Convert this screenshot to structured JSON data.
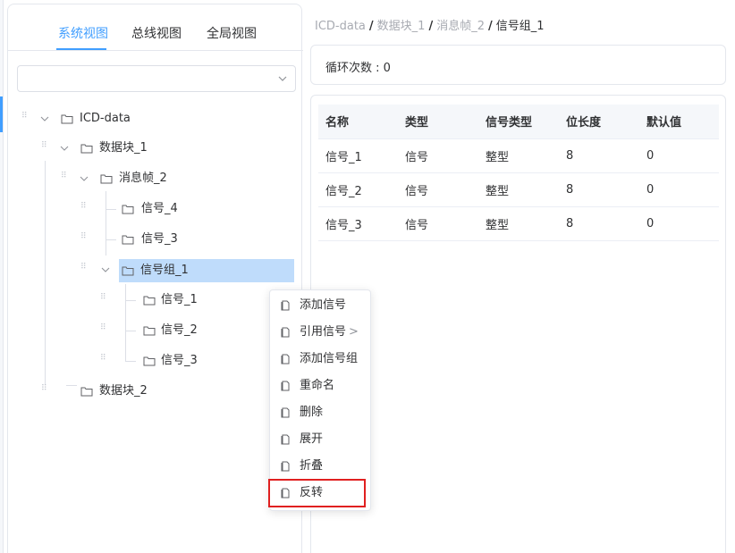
{
  "tabs": [
    {
      "label": "系统视图",
      "active": true
    },
    {
      "label": "总线视图",
      "active": false
    },
    {
      "label": "全局视图",
      "active": false
    }
  ],
  "select": {
    "value": ""
  },
  "tree": {
    "root": "ICD-data",
    "block1": "数据块_1",
    "frame2": "消息帧_2",
    "signal4": "信号_4",
    "signal3": "信号_3",
    "group1": "信号组_1",
    "g_signal1": "信号_1",
    "g_signal2": "信号_2",
    "g_signal3": "信号_3",
    "block2": "数据块_2"
  },
  "breadcrumb": [
    "ICD-data",
    "数据块_1",
    "消息帧_2",
    "信号组_1"
  ],
  "breadcrumb_sep": "/",
  "loop": {
    "label": "循环次数 : 0"
  },
  "table": {
    "headers": [
      "名称",
      "类型",
      "信号类型",
      "位长度",
      "默认值"
    ],
    "rows": [
      [
        "信号_1",
        "信号",
        "整型",
        "8",
        "0"
      ],
      [
        "信号_2",
        "信号",
        "整型",
        "8",
        "0"
      ],
      [
        "信号_3",
        "信号",
        "整型",
        "8",
        "0"
      ]
    ]
  },
  "context_menu": {
    "items": [
      "添加信号",
      "引用信号",
      "添加信号组",
      "重命名",
      "删除",
      "展开",
      "折叠",
      "反转"
    ],
    "submenu_arrow": ">",
    "highlighted_item": "反转",
    "highlight_color": "#e02020"
  },
  "colors": {
    "accent": "#409eff",
    "selected_row": "#bfdcfb"
  },
  "icons": {
    "tree": "folder-icon",
    "menu": "document-icon",
    "caret": "chevron-down-icon"
  }
}
